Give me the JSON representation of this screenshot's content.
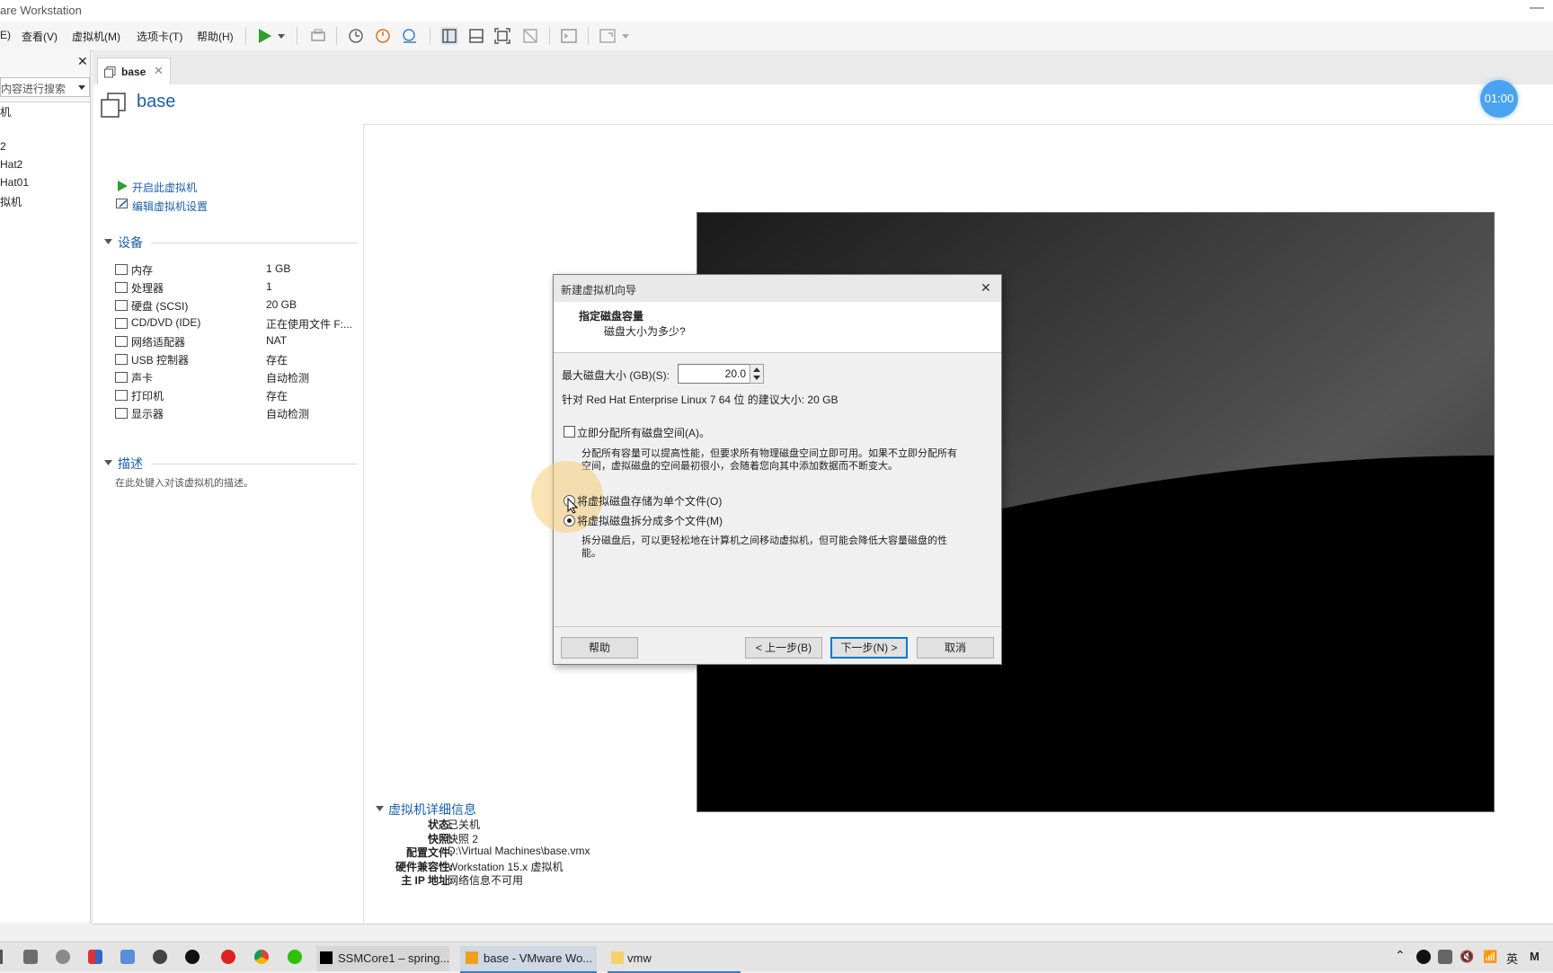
{
  "window": {
    "title": "are Workstation"
  },
  "menu": [
    "E)",
    "查看(V)",
    "虚拟机(M)",
    "选项卡(T)",
    "帮助(H)"
  ],
  "library": {
    "search_placeholder": "内容进行搜索",
    "items": [
      "机",
      "",
      "2",
      "Hat2",
      "Hat01",
      "拟机"
    ]
  },
  "tab": {
    "label": "base"
  },
  "vm": {
    "name": "base",
    "actions": {
      "power_on": "开启此虚拟机",
      "edit_settings": "编辑虚拟机设置"
    },
    "devices_title": "设备",
    "devices": [
      {
        "name": "内存",
        "value": "1 GB",
        "icon": "memory-icon"
      },
      {
        "name": "处理器",
        "value": "1",
        "icon": "cpu-icon"
      },
      {
        "name": "硬盘 (SCSI)",
        "value": "20 GB",
        "icon": "harddisk-icon"
      },
      {
        "name": "CD/DVD (IDE)",
        "value": "正在使用文件 F:...",
        "icon": "cdrom-icon"
      },
      {
        "name": "网络适配器",
        "value": "NAT",
        "icon": "network-icon"
      },
      {
        "name": "USB 控制器",
        "value": "存在",
        "icon": "usb-icon"
      },
      {
        "name": "声卡",
        "value": "自动检测",
        "icon": "sound-icon"
      },
      {
        "name": "打印机",
        "value": "存在",
        "icon": "printer-icon"
      },
      {
        "name": "显示器",
        "value": "自动检测",
        "icon": "display-icon"
      }
    ],
    "description_title": "描述",
    "description_placeholder": "在此处键入对该虚拟机的描述。",
    "details_title": "虚拟机详细信息",
    "details": [
      {
        "k": "状态:",
        "v": "已关机"
      },
      {
        "k": "快照:",
        "v": "快照 2"
      },
      {
        "k": "配置文件:",
        "v": "D:\\Virtual Machines\\base.vmx"
      },
      {
        "k": "硬件兼容性:",
        "v": "Workstation 15.x 虚拟机"
      },
      {
        "k": "主 IP 地址:",
        "v": "网络信息不可用"
      }
    ]
  },
  "timer": "01:00",
  "dialog": {
    "title": "新建虚拟机向导",
    "heading": "指定磁盘容量",
    "subheading": "磁盘大小为多少?",
    "max_size_label": "最大磁盘大小 (GB)(S):",
    "max_size_value": "20.0",
    "recommend": "针对 Red Hat Enterprise Linux 7 64 位 的建议大小: 20 GB",
    "allocate_label": "立即分配所有磁盘空间(A)。",
    "allocate_desc1": "分配所有容量可以提高性能，但要求所有物理磁盘空间立即可用。如果不立即分配所有",
    "allocate_desc2": "空间，虚拟磁盘的空间最初很小，会随着您向其中添加数据而不断变大。",
    "single_file_label": "将虚拟磁盘存储为单个文件(O)",
    "multi_file_label": "将虚拟磁盘拆分成多个文件(M)",
    "multi_desc1": "拆分磁盘后，可以更轻松地在计算机之间移动虚拟机，但可能会降低大容量磁盘的性",
    "multi_desc2": "能。",
    "buttons": {
      "help": "帮助",
      "back": "< 上一步(B)",
      "next": "下一步(N) >",
      "cancel": "取消"
    }
  },
  "taskbar": {
    "apps": [
      "SSMCore1 – spring...",
      "base - VMware Wo...",
      "vmw"
    ],
    "tray": {
      "ime": "英",
      "last": "M"
    }
  }
}
